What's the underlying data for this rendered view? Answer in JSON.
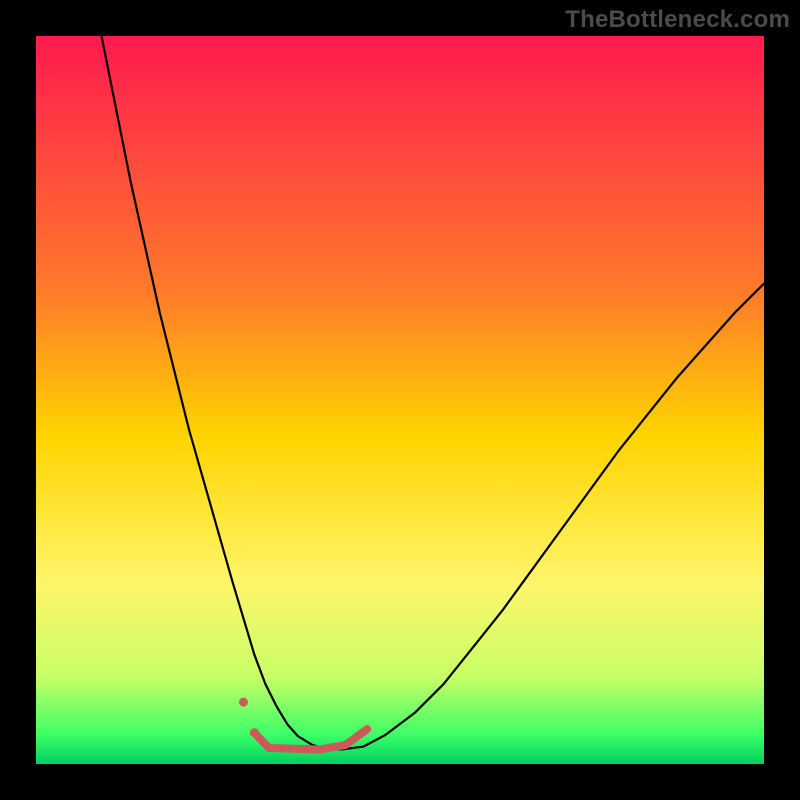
{
  "watermark": "TheBottleneck.com",
  "chart_data": {
    "type": "line",
    "title": "",
    "xlabel": "",
    "ylabel": "",
    "xlim": [
      0,
      100
    ],
    "ylim": [
      0,
      100
    ],
    "gradient_stops": [
      {
        "offset": 0,
        "color": "#ff1a4f"
      },
      {
        "offset": 35,
        "color": "#ff7a2a"
      },
      {
        "offset": 55,
        "color": "#ffd400"
      },
      {
        "offset": 75,
        "color": "#fff56a"
      },
      {
        "offset": 88,
        "color": "#c8ff66"
      },
      {
        "offset": 96,
        "color": "#3cff66"
      },
      {
        "offset": 100,
        "color": "#00d060"
      }
    ],
    "series": [
      {
        "name": "bottleneck-curve",
        "stroke": "#000000",
        "stroke_width": 2.2,
        "x": [
          9,
          11,
          13,
          15,
          17,
          19,
          21,
          23,
          25,
          27,
          28.5,
          30,
          31.5,
          33,
          34.5,
          36,
          38,
          40,
          42,
          45,
          48,
          52,
          56,
          60,
          64,
          68,
          72,
          76,
          80,
          84,
          88,
          92,
          96,
          100
        ],
        "y": [
          100,
          90,
          80,
          71,
          62,
          54,
          46,
          39,
          32,
          25,
          20,
          15,
          11,
          8,
          5.5,
          3.8,
          2.6,
          2.0,
          2.0,
          2.4,
          4,
          7,
          11,
          16,
          21,
          26.5,
          32,
          37.5,
          43,
          48,
          53,
          57.5,
          62,
          66
        ]
      }
    ],
    "markers": {
      "stroke": "#cc5a5a",
      "stroke_width": 8,
      "dot_radius": 4.5,
      "points": [
        {
          "x": 28.5,
          "y": 8.5,
          "type": "dot"
        },
        {
          "x": 30.0,
          "y": 4.3,
          "type": "dot"
        },
        {
          "x1": 30.0,
          "y1": 4.3,
          "x2": 32.0,
          "y2": 2.2,
          "type": "seg"
        },
        {
          "x1": 32.0,
          "y1": 2.2,
          "x2": 39.0,
          "y2": 2.0,
          "type": "seg"
        },
        {
          "x1": 39.0,
          "y1": 2.0,
          "x2": 42.5,
          "y2": 2.6,
          "type": "seg"
        },
        {
          "x1": 42.5,
          "y1": 2.6,
          "x2": 45.5,
          "y2": 4.8,
          "type": "seg"
        }
      ]
    }
  }
}
